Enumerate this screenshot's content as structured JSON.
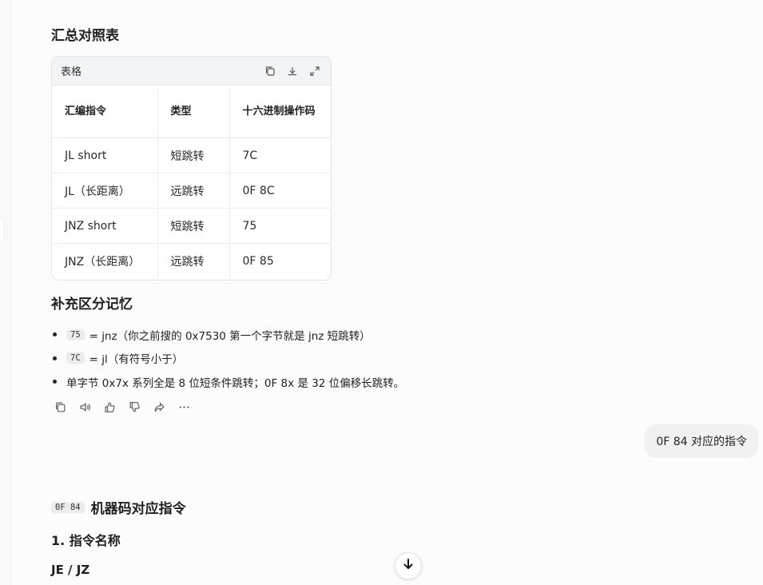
{
  "summary_title": "汇总对照表",
  "table": {
    "label": "表格",
    "headers": [
      "汇编指令",
      "类型",
      "十六进制操作码"
    ],
    "rows": [
      [
        "JL short",
        "短跳转",
        "7C"
      ],
      [
        "JL（长距离）",
        "远跳转",
        "0F 8C"
      ],
      [
        "JNZ short",
        "短跳转",
        "75"
      ],
      [
        "JNZ（长距离）",
        "远跳转",
        "0F 85"
      ]
    ]
  },
  "supplement_title": "补充区分记忆",
  "bullets": [
    {
      "code": "75",
      "text": "= jnz（你之前搜的 0x7530 第一个字节就是 jnz 短跳转）"
    },
    {
      "code": "7C",
      "text": "= jl（有符号小于）"
    },
    {
      "code": "",
      "text": "单字节 0x7x 系列全是 8 位短条件跳转；0F 8x 是 32 位偏移长跳转。"
    }
  ],
  "user_message": "0F 84 对应的指令",
  "machine_title": {
    "code": "0F 84",
    "text": "机器码对应指令"
  },
  "section1_title": "1. 指令名称",
  "je_title": "JE / JZ",
  "icons": {
    "table": [
      "copy-icon",
      "download-icon",
      "expand-icon"
    ],
    "actions": [
      "copy-icon",
      "speaker-icon",
      "thumbs-up-icon",
      "thumbs-down-icon",
      "share-icon",
      "more-icon"
    ],
    "scroll": "arrow-down-icon"
  }
}
